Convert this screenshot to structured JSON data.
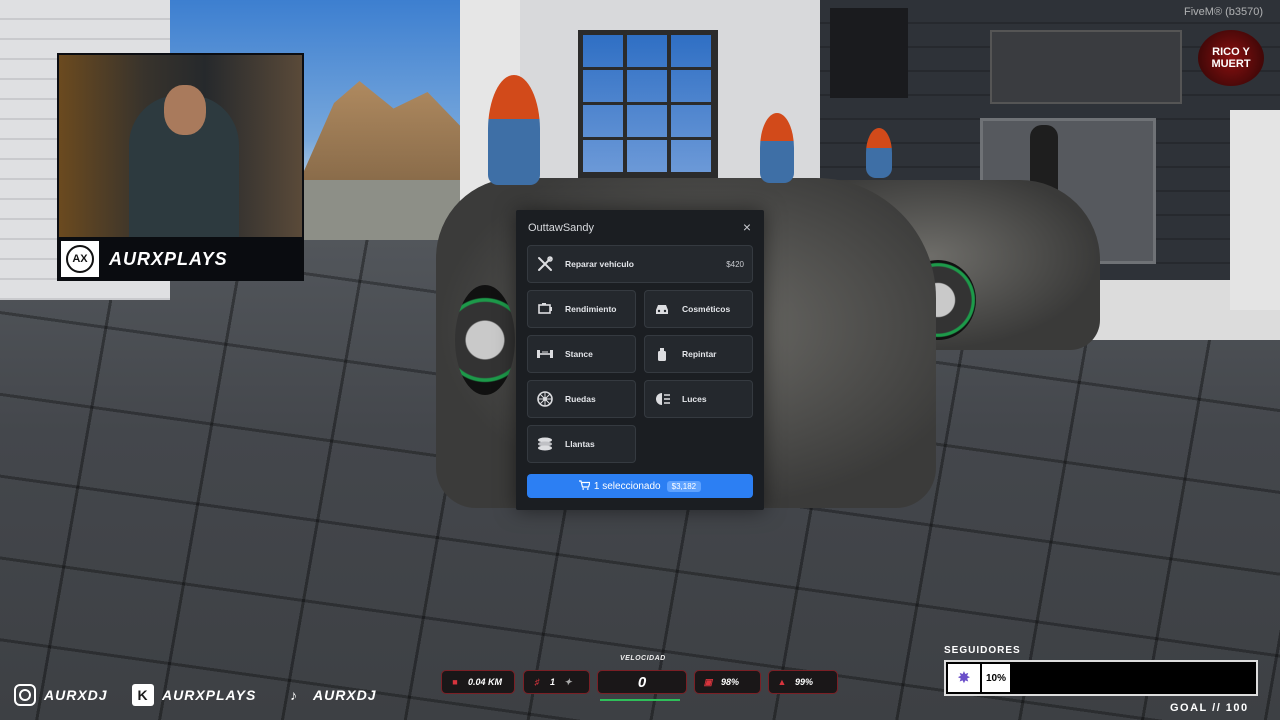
{
  "window": {
    "fivem_label": "FiveM® (b3570)"
  },
  "webcam": {
    "channel_name": "AURXPLAYS",
    "logo_text": "AX"
  },
  "server_logo": {
    "text": "RICO Y MUERT"
  },
  "dialog": {
    "title": "OuttawSandy",
    "close_icon": "×",
    "repair": {
      "label": "Reparar vehículo",
      "price": "$420",
      "icon": "wrench-screwdriver-icon"
    },
    "options": [
      {
        "label": "Rendimiento",
        "icon": "engine-icon"
      },
      {
        "label": "Cosméticos",
        "icon": "car-front-icon"
      },
      {
        "label": "Stance",
        "icon": "suspension-icon"
      },
      {
        "label": "Repintar",
        "icon": "spray-can-icon"
      },
      {
        "label": "Ruedas",
        "icon": "wheel-icon"
      },
      {
        "label": "Luces",
        "icon": "headlight-icon"
      },
      {
        "label": "Llantas",
        "icon": "tires-icon"
      }
    ],
    "cta": {
      "label": "1 seleccionado",
      "total": "$3,182",
      "icon": "cart-icon"
    }
  },
  "hud": {
    "speed_label": "VELOCIDAD",
    "distance": "0.04 KM",
    "gear": "1",
    "speed": "0",
    "fuel": "98%",
    "engine_health": "99%"
  },
  "socials": [
    {
      "platform": "instagram",
      "handle": "AURXDJ"
    },
    {
      "platform": "kick",
      "handle": "AURXPLAYS"
    },
    {
      "platform": "tiktok",
      "handle": "AURXDJ"
    }
  ],
  "followers": {
    "label": "SEGUIDORES",
    "percent": "10%",
    "progress": 0.1,
    "goal": "GOAL // 100"
  },
  "colors": {
    "accent_blue": "#2c7ff3",
    "hud_red": "#d8343d",
    "dialog_bg": "#1b1e22"
  }
}
